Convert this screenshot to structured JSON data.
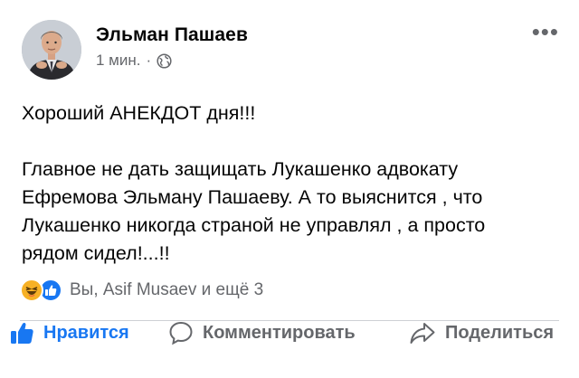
{
  "post": {
    "author": "Эльман Пашаев",
    "time": "1 мин.",
    "separator": "·",
    "privacy_icon": "globe-icon",
    "more_label": "•••",
    "text_line1": "Хороший АНЕКДОТ дня!!!",
    "text_paragraph": "Главное не дать защищать Лукашенко адвокату\nЕфремова Эльману Пашаеву. А то выяснится , что\nЛукашенко никогда страной не управлял , а просто\nрядом сидел!...!!"
  },
  "reactions": {
    "icons": [
      "haha-reaction-icon",
      "like-reaction-icon"
    ],
    "summary": "Вы, Asif Musaev и ещё 3"
  },
  "actions": {
    "like": "Нравится",
    "comment": "Комментировать",
    "share": "Поделиться"
  },
  "colors": {
    "accent": "#1877f2",
    "secondary_text": "#65676b",
    "divider": "#ced0d4",
    "haha": "#f7b125"
  }
}
